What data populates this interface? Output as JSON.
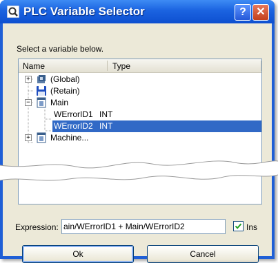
{
  "window": {
    "title": "PLC Variable Selector",
    "help_label": "?",
    "close_label": "✕"
  },
  "prompt": "Select a variable below.",
  "tree": {
    "columns": [
      "Name",
      "Type"
    ],
    "rows": [
      {
        "expander": "+",
        "icon": "global-icon",
        "name": "(Global)",
        "type": ""
      },
      {
        "expander": "",
        "icon": "disk-icon",
        "name": "(Retain)",
        "type": ""
      },
      {
        "expander": "−",
        "icon": "program-icon",
        "name": "Main",
        "type": ""
      },
      {
        "expander": "",
        "icon": "",
        "name": "WErrorID1",
        "type": "INT"
      },
      {
        "expander": "",
        "icon": "",
        "name": "WErrorID2",
        "type": "INT",
        "selected": true
      },
      {
        "expander": "+",
        "icon": "program-icon",
        "name": "Machine...",
        "type": ""
      }
    ]
  },
  "expression": {
    "label": "Expression:",
    "value": "ain/WErrorID1 + Main/WErrorID2"
  },
  "insert_checkbox": {
    "label": "Ins",
    "checked": true
  },
  "buttons": {
    "ok": "Ok",
    "cancel": "Cancel"
  },
  "colors": {
    "selection": "#3169c6",
    "titlebar": "#1b63e0",
    "dialog_bg": "#ece9d8"
  }
}
